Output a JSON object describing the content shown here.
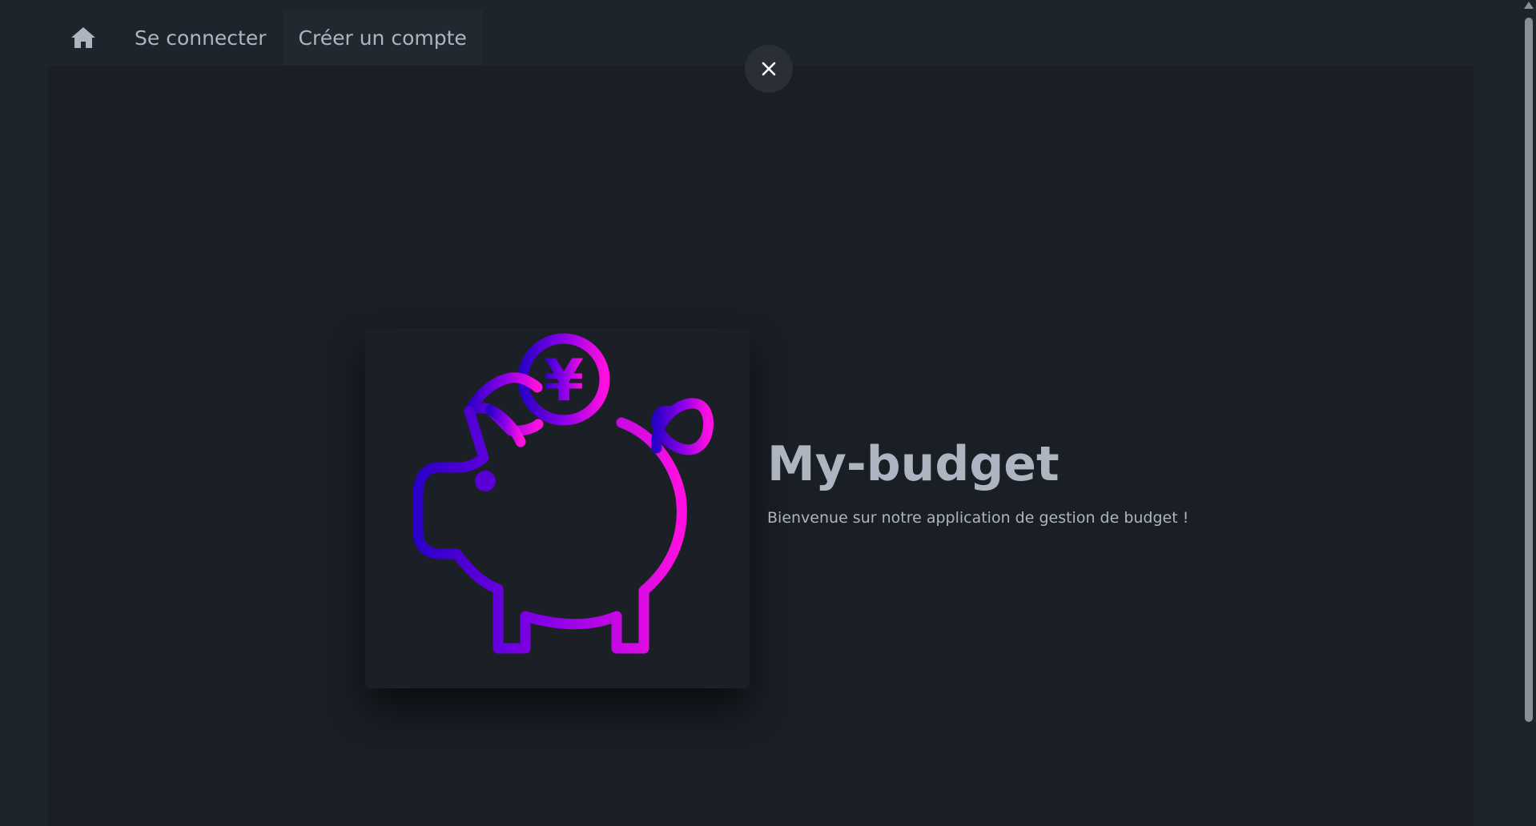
{
  "nav": {
    "home_icon": "home-icon",
    "links": [
      {
        "label": "Se connecter"
      },
      {
        "label": "Créer un compte"
      }
    ]
  },
  "close_icon": "close-icon",
  "hero": {
    "icon": "piggy-bank-yen-icon",
    "coin_symbol": "¥",
    "title": "My-budget",
    "subtitle": "Bienvenue sur notre application de gestion de budget !"
  },
  "colors": {
    "background": "#1e242c",
    "content_background": "#1a1e25",
    "text": "#aeb4c0",
    "gradient_start": "#2b00c8",
    "gradient_mid": "#8a00e8",
    "gradient_end": "#ff10e0"
  }
}
